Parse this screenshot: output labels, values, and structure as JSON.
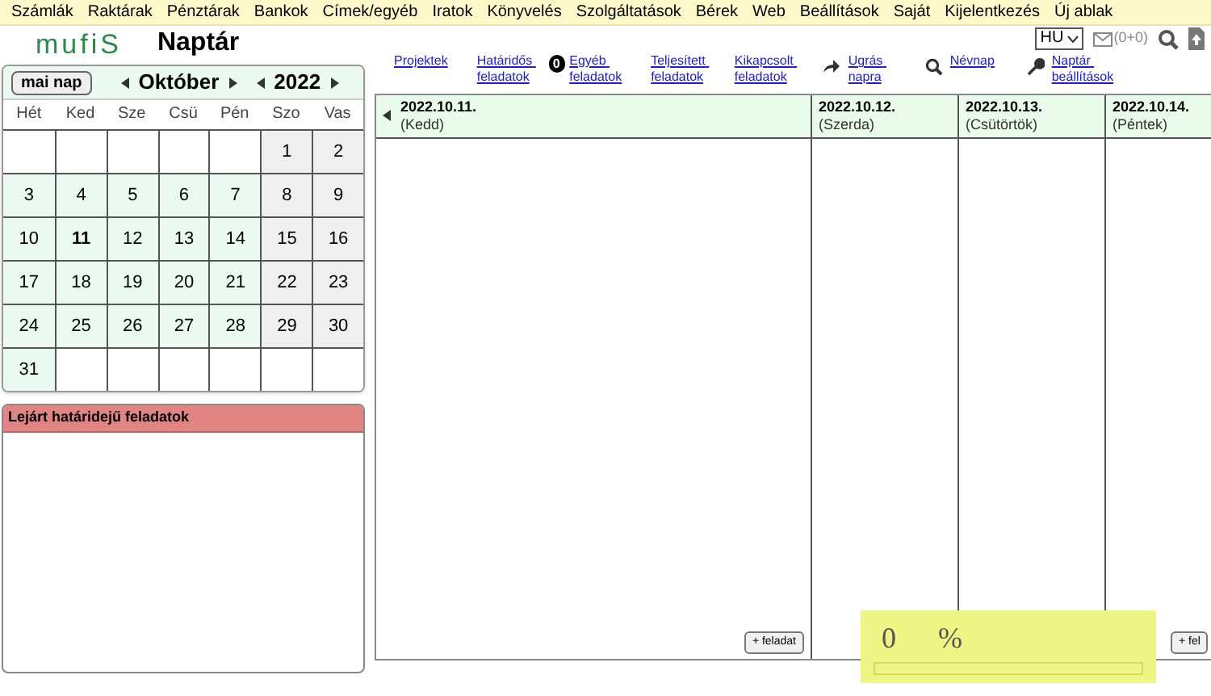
{
  "menu": [
    "Számlák",
    "Raktárak",
    "Pénztárak",
    "Bankok",
    "Címek/egyéb",
    "Iratok",
    "Könyvelés",
    "Szolgáltatások",
    "Bérek",
    "Web",
    "Beállítások",
    "Saját",
    "Kijelentkezés",
    "Új ablak"
  ],
  "logo": "mufiS",
  "page_title": "Naptár",
  "language": "HU",
  "messages": "(0+0)",
  "calendar": {
    "today_button": "mai nap",
    "month": "Október",
    "year": "2022",
    "weekdays": [
      "Hét",
      "Ked",
      "Sze",
      "Csü",
      "Pén",
      "Szo",
      "Vas"
    ],
    "weeks": [
      [
        {
          "kind": "empty"
        },
        {
          "kind": "empty"
        },
        {
          "kind": "empty"
        },
        {
          "kind": "empty"
        },
        {
          "kind": "empty"
        },
        {
          "kind": "day",
          "label": "1",
          "today": false
        },
        {
          "kind": "day",
          "label": "2",
          "today": false
        }
      ],
      [
        {
          "kind": "day",
          "label": "3",
          "today": false
        },
        {
          "kind": "day",
          "label": "4",
          "today": false
        },
        {
          "kind": "day",
          "label": "5",
          "today": false
        },
        {
          "kind": "day",
          "label": "6",
          "today": false
        },
        {
          "kind": "day",
          "label": "7",
          "today": false
        },
        {
          "kind": "day",
          "label": "8",
          "today": false
        },
        {
          "kind": "day",
          "label": "9",
          "today": false
        }
      ],
      [
        {
          "kind": "day",
          "label": "10",
          "today": false
        },
        {
          "kind": "day",
          "label": "11",
          "today": true
        },
        {
          "kind": "day",
          "label": "12",
          "today": false
        },
        {
          "kind": "day",
          "label": "13",
          "today": false
        },
        {
          "kind": "day",
          "label": "14",
          "today": false
        },
        {
          "kind": "day",
          "label": "15",
          "today": false
        },
        {
          "kind": "day",
          "label": "16",
          "today": false
        }
      ],
      [
        {
          "kind": "day",
          "label": "17",
          "today": false
        },
        {
          "kind": "day",
          "label": "18",
          "today": false
        },
        {
          "kind": "day",
          "label": "19",
          "today": false
        },
        {
          "kind": "day",
          "label": "20",
          "today": false
        },
        {
          "kind": "day",
          "label": "21",
          "today": false
        },
        {
          "kind": "day",
          "label": "22",
          "today": false
        },
        {
          "kind": "day",
          "label": "23",
          "today": false
        }
      ],
      [
        {
          "kind": "day",
          "label": "24",
          "today": false
        },
        {
          "kind": "day",
          "label": "25",
          "today": false
        },
        {
          "kind": "day",
          "label": "26",
          "today": false
        },
        {
          "kind": "day",
          "label": "27",
          "today": false
        },
        {
          "kind": "day",
          "label": "28",
          "today": false
        },
        {
          "kind": "day",
          "label": "29",
          "today": false
        },
        {
          "kind": "day",
          "label": "30",
          "today": false
        }
      ],
      [
        {
          "kind": "day",
          "label": "31",
          "today": false
        },
        {
          "kind": "empty"
        },
        {
          "kind": "empty"
        },
        {
          "kind": "empty"
        },
        {
          "kind": "empty"
        },
        {
          "kind": "empty"
        },
        {
          "kind": "empty"
        }
      ]
    ]
  },
  "overdue_panel": {
    "title": "Lejárt határidejű feladatok"
  },
  "toolbar": [
    {
      "kind": "link",
      "label": "Projektek"
    },
    {
      "kind": "link",
      "label": "Határidős feladatok"
    },
    {
      "kind": "badge",
      "label": "0"
    },
    {
      "kind": "link",
      "label": "Egyéb feladatok"
    },
    {
      "kind": "link",
      "label": "Teljesített feladatok"
    },
    {
      "kind": "link",
      "label": "Kikapcsolt feladatok"
    },
    {
      "kind": "jump",
      "label": "Ugrás napra"
    },
    {
      "kind": "search",
      "label": "Névnap"
    },
    {
      "kind": "settings",
      "label": "Naptár beállítások"
    }
  ],
  "days": [
    {
      "date": "2022.10.11.",
      "weekday": "(Kedd)",
      "add_button": "+ feladat"
    },
    {
      "date": "2022.10.12.",
      "weekday": "(Szerda)"
    },
    {
      "date": "2022.10.13.",
      "weekday": "(Csütörtök)"
    },
    {
      "date": "2022.10.14.",
      "weekday": "(Péntek)",
      "add_button": "+ fel"
    }
  ],
  "progress": {
    "value": "0",
    "unit": "%",
    "level": 0
  }
}
